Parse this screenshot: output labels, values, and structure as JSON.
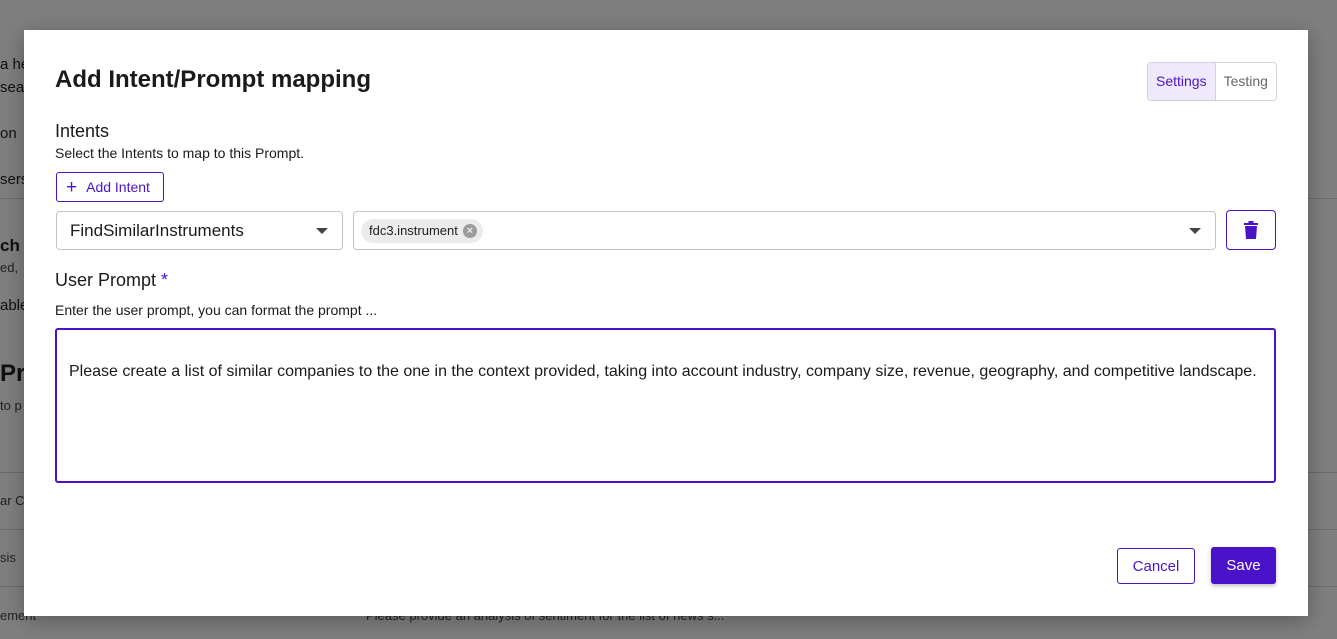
{
  "background": {
    "fragments": [
      {
        "text": "a he",
        "cls": "bg-text"
      },
      {
        "text": "sea",
        "cls": "bg-text"
      },
      {
        "text": "on",
        "cls": "bg-text"
      },
      {
        "text": "sers",
        "cls": "bg-text"
      },
      {
        "text": "ch",
        "cls": "bg-text bg-bold"
      },
      {
        "text": "ed, ",
        "cls": "bg-text bg-small"
      },
      {
        "text": "able",
        "cls": "bg-text"
      },
      {
        "text": "Pr",
        "cls": "bg-text bg-big"
      },
      {
        "text": "to p",
        "cls": "bg-text bg-small"
      },
      {
        "text": "ar C",
        "cls": "bg-text bg-small"
      },
      {
        "text": "sis",
        "cls": "bg-text bg-small"
      },
      {
        "text": "ement",
        "cls": "bg-text bg-small"
      },
      {
        "text": "Please provide an analysis of sentiment for the list of news s...",
        "cls": "bg-text bg-small"
      }
    ]
  },
  "modal": {
    "title": "Add Intent/Prompt mapping",
    "tabs": [
      {
        "label": "Settings",
        "active": true
      },
      {
        "label": "Testing",
        "active": false
      }
    ],
    "intents": {
      "heading": "Intents",
      "hint": "Select the Intents to map to this Prompt.",
      "add_button": "Add Intent",
      "rows": [
        {
          "intent": "FindSimilarInstruments",
          "contexts": [
            "fdc3.instrument"
          ]
        }
      ]
    },
    "user_prompt": {
      "heading": "User Prompt",
      "required_mark": "*",
      "hint": "Enter the user prompt, you can format the prompt ...",
      "value": "Please create a list of similar companies to the one in the context provided, taking into account industry, company size, revenue, geography, and competitive landscape."
    },
    "actions": {
      "cancel": "Cancel",
      "save": "Save"
    }
  },
  "colors": {
    "accent": "#4a13c9",
    "overlay": "rgba(0,0,0,0.5)"
  }
}
